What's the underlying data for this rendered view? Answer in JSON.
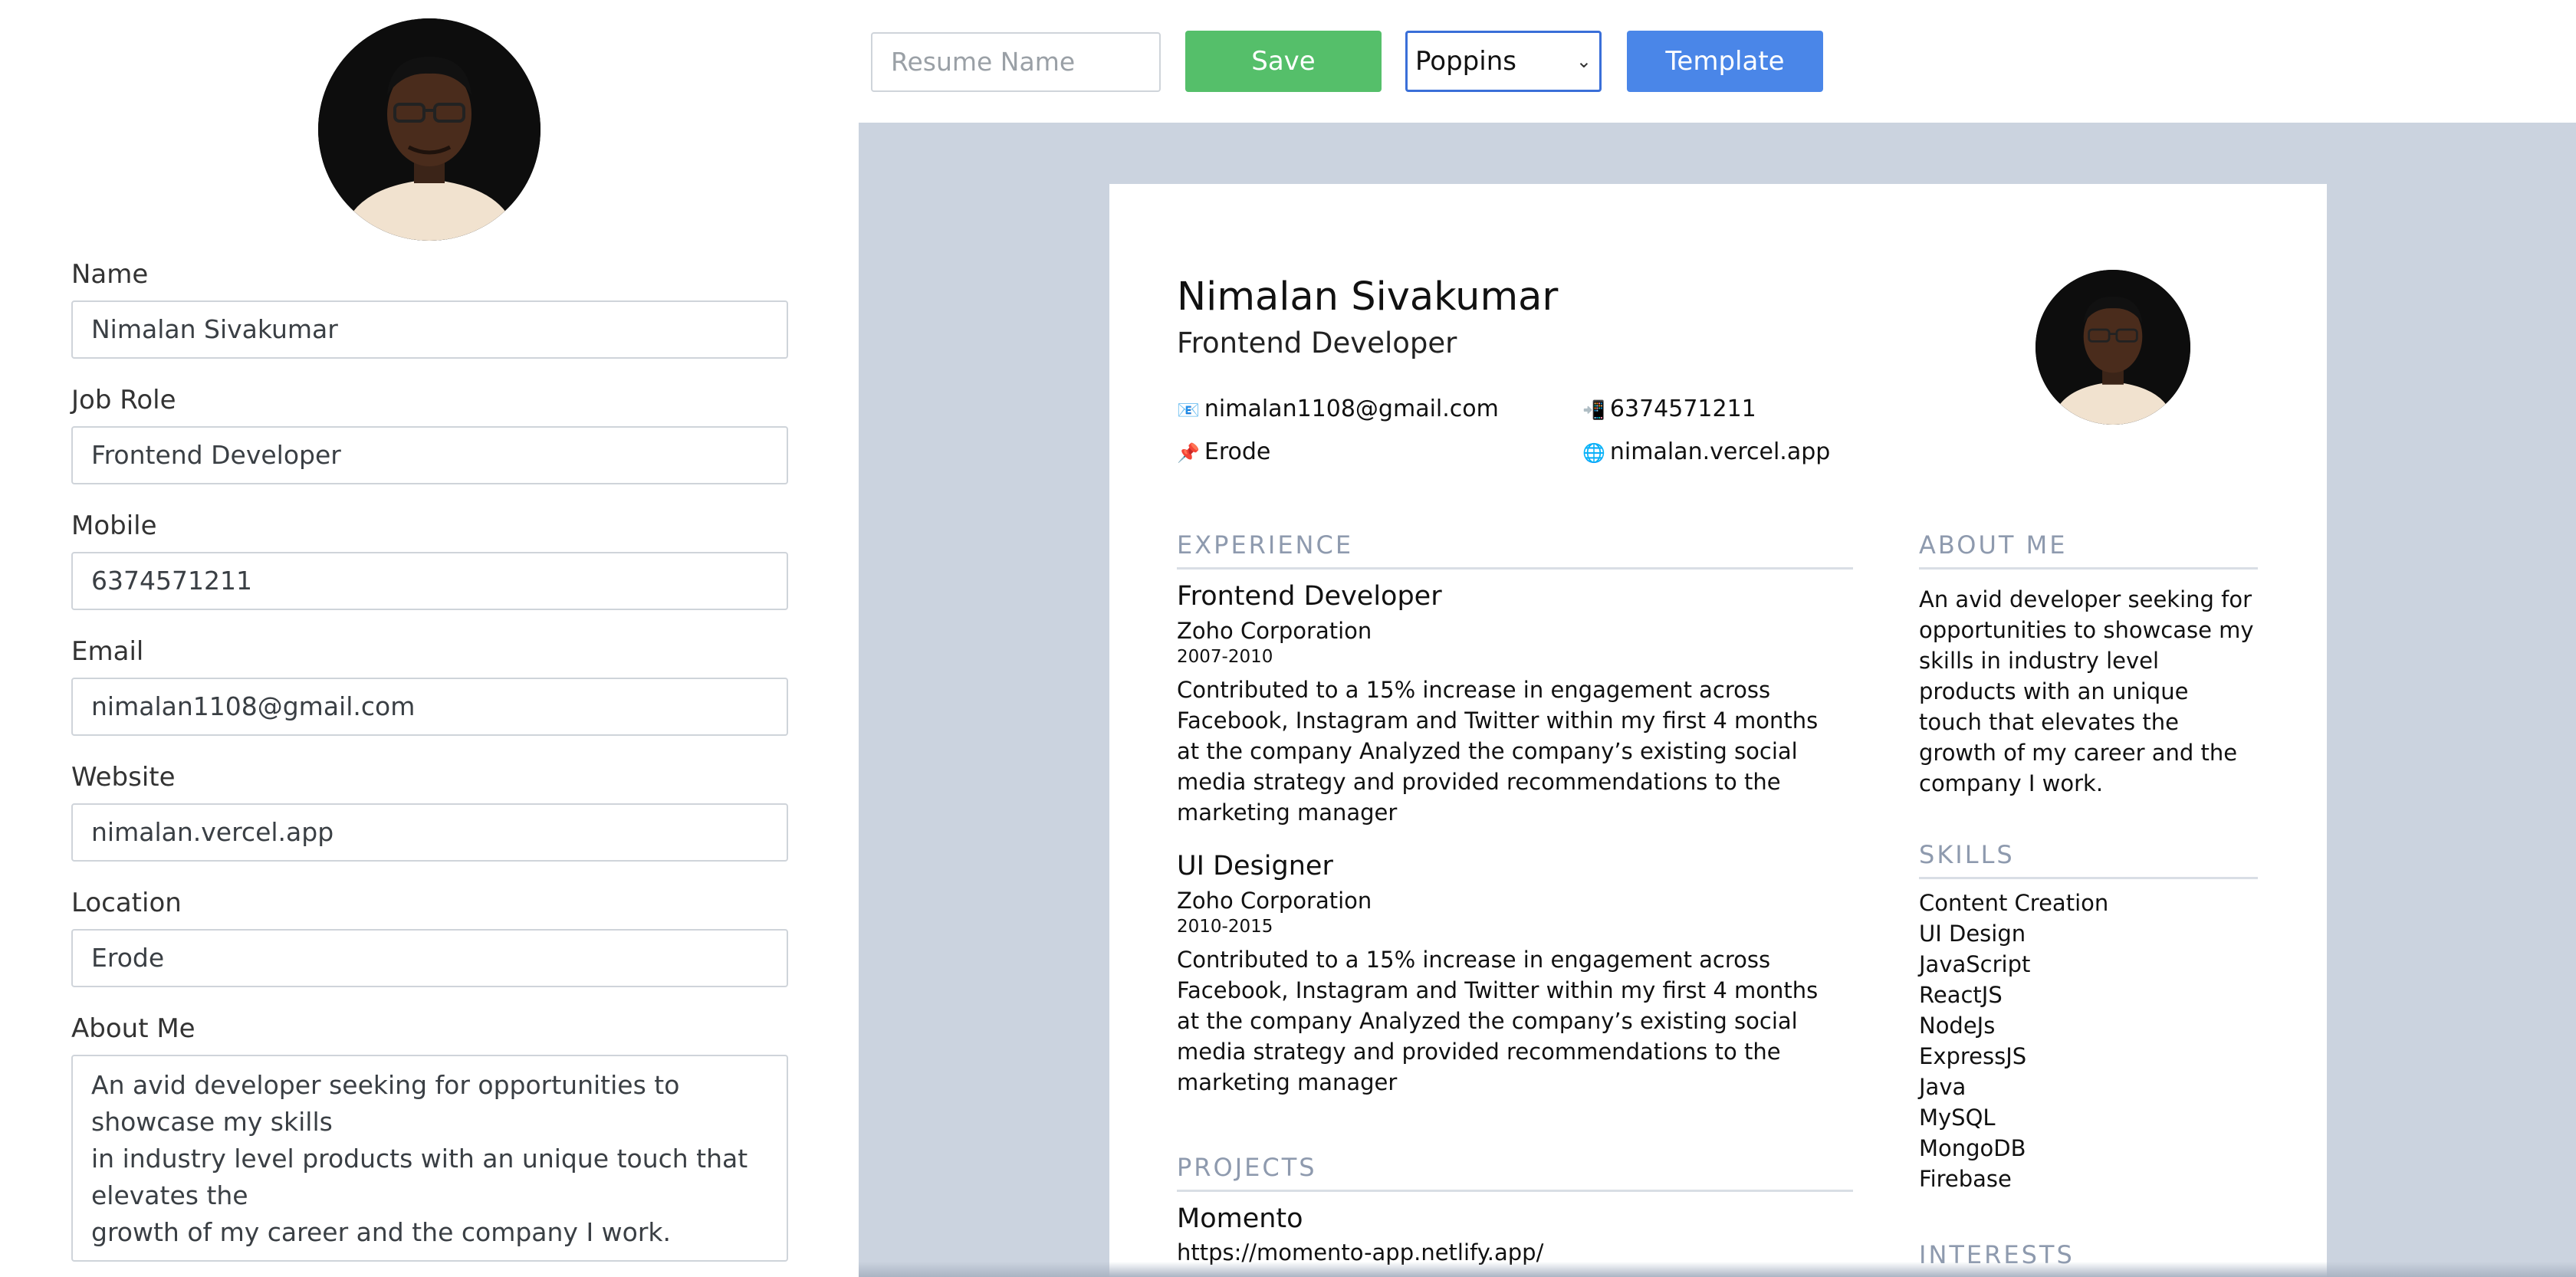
{
  "form": {
    "fields": [
      {
        "label": "Name",
        "value": "Nimalan Sivakumar"
      },
      {
        "label": "Job Role",
        "value": "Frontend Developer"
      },
      {
        "label": "Mobile",
        "value": "6374571211"
      },
      {
        "label": "Email",
        "value": "nimalan1108@gmail.com"
      },
      {
        "label": "Website",
        "value": "nimalan.vercel.app"
      },
      {
        "label": "Location",
        "value": "Erode"
      }
    ],
    "about_label": "About Me",
    "about_value": "An avid developer seeking for opportunities to\nshowcase my skills\nin industry level products with an unique touch that\nelevates the\ngrowth of my career and the company I work."
  },
  "toolbar": {
    "resume_name_placeholder": "Resume Name",
    "save_label": "Save",
    "font_selected": "Poppins",
    "template_label": "Template"
  },
  "resume": {
    "name": "Nimalan Sivakumar",
    "role": "Frontend Developer",
    "email": "nimalan1108@gmail.com",
    "phone": "6374571211",
    "location": "Erode",
    "website": "nimalan.vercel.app",
    "experience_heading": "EXPERIENCE",
    "experience": [
      {
        "title": "Frontend Developer",
        "company": "Zoho Corporation",
        "dates": "2007-2010",
        "description": "Contributed to a 15% increase in engagement across Facebook, Instagram and Twitter within my first 4 months at the company Analyzed the company’s existing social media strategy and provided recommendations to the marketing manager"
      },
      {
        "title": "UI Designer",
        "company": "Zoho Corporation",
        "dates": "2010-2015",
        "description": "Contributed to a 15% increase in engagement across Facebook, Instagram and Twitter within my first 4 months at the company Analyzed the company’s existing social media strategy and provided recommendations to the marketing manager"
      }
    ],
    "projects_heading": "PROJECTS",
    "projects": [
      {
        "title": "Momento",
        "link": "https://momento-app.netlify.app/"
      }
    ],
    "about_heading": "ABOUT ME",
    "about": "An avid developer seeking for opportunities to showcase my skills in industry level products with an unique touch that elevates the growth of my career and the company I work.",
    "skills_heading": "SKILLS",
    "skills": [
      "Content Creation",
      "UI Design",
      "JavaScript",
      "ReactJS",
      "NodeJs",
      "ExpressJS",
      "Java",
      "MySQL",
      "MongoDB",
      "Firebase"
    ],
    "interests_heading": "INTERESTS"
  },
  "colors": {
    "save": "#55bf6a",
    "template": "#4a86e8",
    "preview_bg": "#cbd3df",
    "section_heading": "#8e9aae"
  },
  "icons": {
    "email": "envelope-icon",
    "phone": "mobile-phone-icon",
    "location": "pushpin-icon",
    "website": "globe-icon"
  }
}
